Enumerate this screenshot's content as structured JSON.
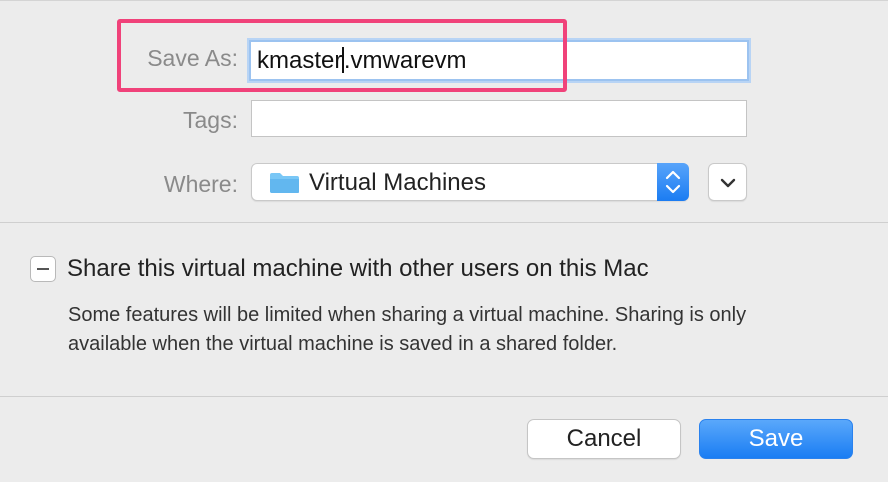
{
  "form": {
    "save_as_label": "Save As:",
    "save_as_value_before_caret": "kmaster",
    "save_as_value_after_caret": ".vmwarevm",
    "tags_label": "Tags:",
    "tags_value": "",
    "where_label": "Where:",
    "where_value": "Virtual Machines"
  },
  "share": {
    "checkbox_state": "mixed",
    "label": "Share this virtual machine with other users on this Mac",
    "description": "Some features will be limited when sharing a virtual machine. Sharing is only available when the virtual machine is saved in a shared folder."
  },
  "buttons": {
    "cancel_label": "Cancel",
    "save_label": "Save"
  },
  "icons": {
    "folder": "folder-icon",
    "stepper": "up-down-chevron-icon",
    "disclosure": "chevron-down-icon"
  },
  "colors": {
    "accent": "#1a7df3",
    "highlight": "#f0427a",
    "folder": "#6cc3f5"
  }
}
